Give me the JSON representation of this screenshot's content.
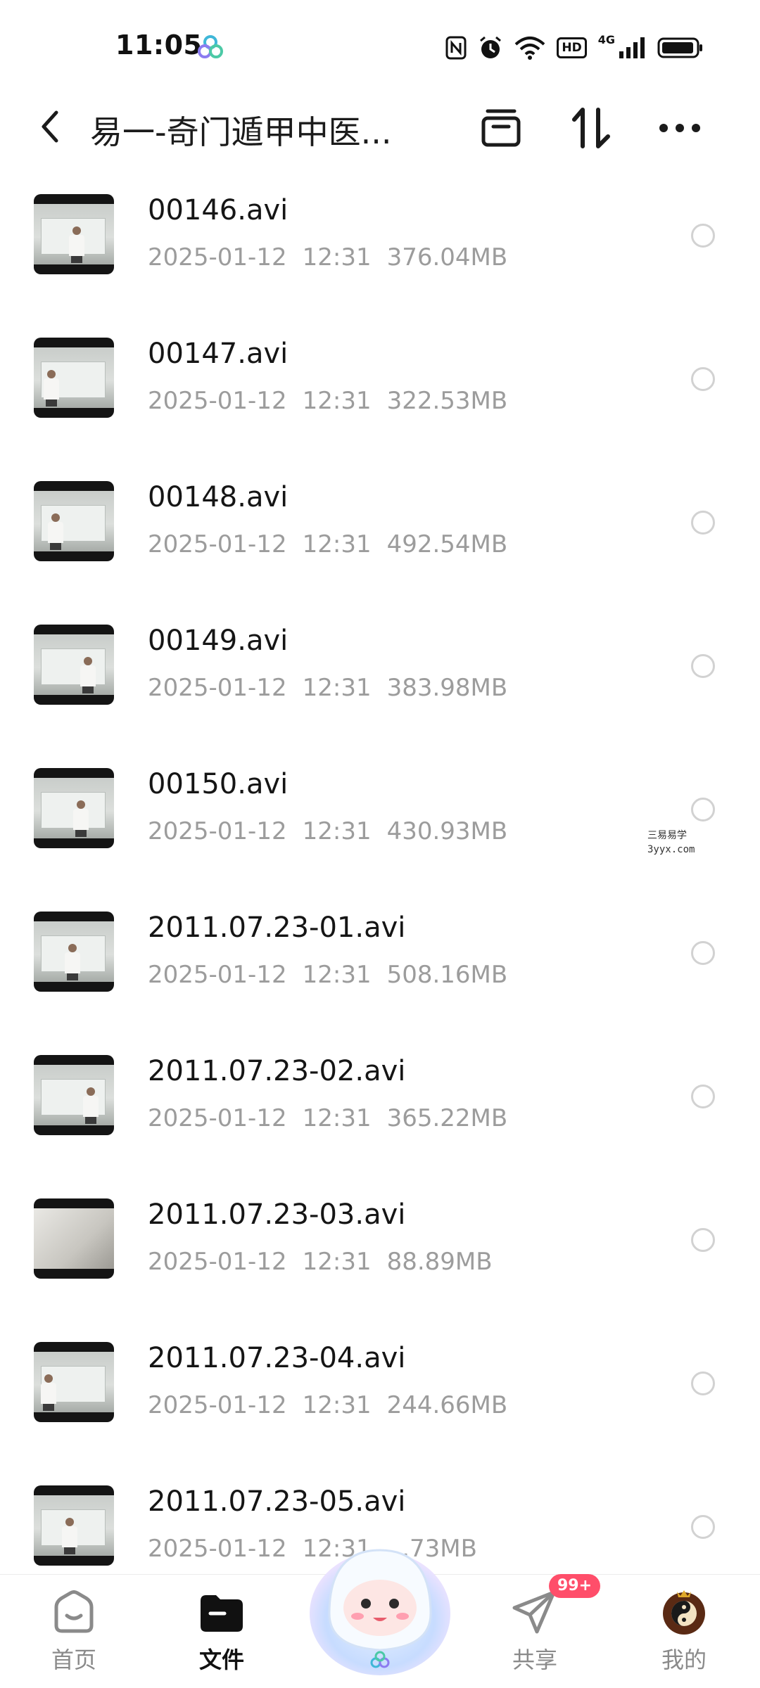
{
  "status_bar": {
    "time": "11:05",
    "hd_label": "HD",
    "network_label": "4G",
    "icons": [
      "nfc-icon",
      "alarm-icon",
      "wifi-icon",
      "hd-icon",
      "signal-icon",
      "battery-icon"
    ]
  },
  "header": {
    "title": "易一-奇门遁甲中医...",
    "icons": [
      "back-arrow-icon",
      "archive-icon",
      "sort-icon",
      "more-icon"
    ]
  },
  "files": [
    {
      "name": "00146.avi",
      "date": "2025-01-12",
      "time": "12:31",
      "size": "376.04MB"
    },
    {
      "name": "00147.avi",
      "date": "2025-01-12",
      "time": "12:31",
      "size": "322.53MB"
    },
    {
      "name": "00148.avi",
      "date": "2025-01-12",
      "time": "12:31",
      "size": "492.54MB"
    },
    {
      "name": "00149.avi",
      "date": "2025-01-12",
      "time": "12:31",
      "size": "383.98MB"
    },
    {
      "name": "00150.avi",
      "date": "2025-01-12",
      "time": "12:31",
      "size": "430.93MB"
    },
    {
      "name": "2011.07.23-01.avi",
      "date": "2025-01-12",
      "time": "12:31",
      "size": "508.16MB"
    },
    {
      "name": "2011.07.23-02.avi",
      "date": "2025-01-12",
      "time": "12:31",
      "size": "365.22MB"
    },
    {
      "name": "2011.07.23-03.avi",
      "date": "2025-01-12",
      "time": "12:31",
      "size": "88.89MB"
    },
    {
      "name": "2011.07.23-04.avi",
      "date": "2025-01-12",
      "time": "12:31",
      "size": "244.66MB"
    },
    {
      "name": "2011.07.23-05.avi",
      "date": "2025-01-12",
      "time": "12:31",
      "size": "...73MB"
    }
  ],
  "watermark": {
    "line1": "三易易学",
    "line2": "3yyx.com"
  },
  "bottom_nav": {
    "items": [
      {
        "label": "首页",
        "icon": "home-icon"
      },
      {
        "label": "文件",
        "icon": "folder-icon"
      },
      {
        "label": "共享",
        "icon": "send-icon"
      },
      {
        "label": "我的",
        "icon": "avatar-icon"
      }
    ],
    "share_badge": "99+",
    "center_icon": "mascot-icon"
  },
  "colors": {
    "badge": "#ff4e6a",
    "meta_text": "#9c9c9c",
    "radio_border": "#d2d2d2"
  }
}
